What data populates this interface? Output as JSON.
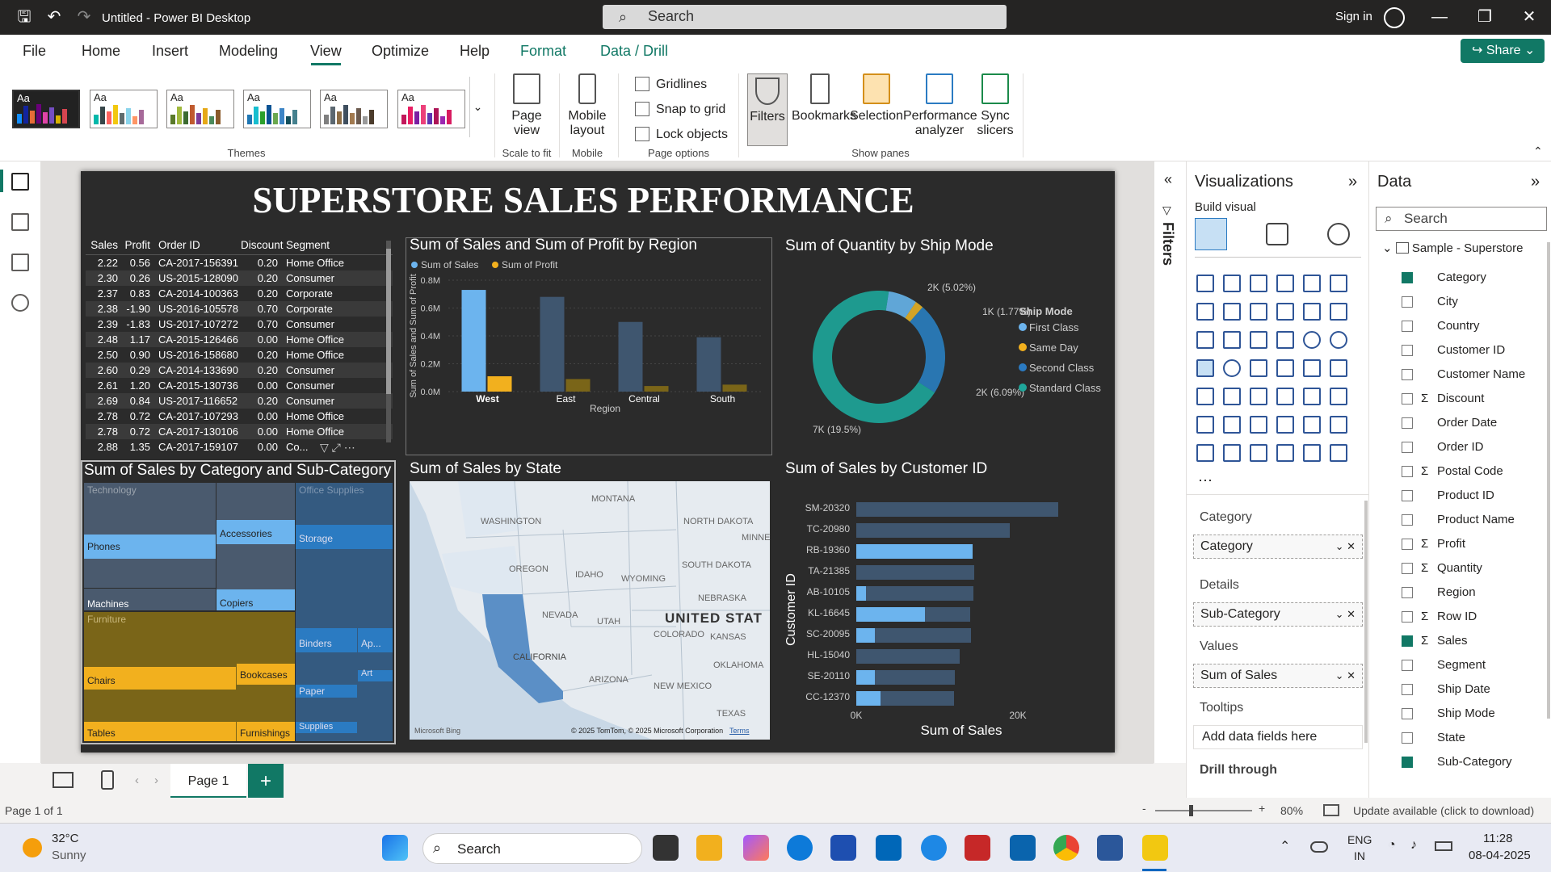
{
  "app": {
    "title": "Untitled - Power BI Desktop",
    "search_placeholder": "Search",
    "signin": "Sign in"
  },
  "menu": {
    "items": [
      "File",
      "Home",
      "Insert",
      "Modeling",
      "View",
      "Optimize",
      "Help",
      "Format",
      "Data / Drill"
    ],
    "share": "Share"
  },
  "ribbon": {
    "themes_label": "Themes",
    "theme_aa": "Aa",
    "page_view": "Page view",
    "scale_to_fit": "Scale to fit",
    "mobile_layout": "Mobile layout",
    "mobile_label": "Mobile",
    "gridlines": "Gridlines",
    "snap_to_grid": "Snap to grid",
    "lock_objects": "Lock objects",
    "page_options_label": "Page options",
    "filters": "Filters",
    "bookmarks": "Bookmarks",
    "selection": "Selection",
    "performance_analyzer": "Performance analyzer",
    "sync_slicers": "Sync slicers",
    "show_panes_label": "Show panes"
  },
  "report": {
    "title": "SUPERSTORE SALES PERFORMANCE",
    "table": {
      "headers": [
        "Sales",
        "Profit",
        "Order ID",
        "Discount",
        "Segment"
      ],
      "rows": [
        [
          "2.22",
          "0.56",
          "CA-2017-156391",
          "0.20",
          "Home Office"
        ],
        [
          "2.30",
          "0.26",
          "US-2015-128090",
          "0.20",
          "Consumer"
        ],
        [
          "2.37",
          "0.83",
          "CA-2014-100363",
          "0.20",
          "Corporate"
        ],
        [
          "2.38",
          "-1.90",
          "US-2016-105578",
          "0.70",
          "Corporate"
        ],
        [
          "2.39",
          "-1.83",
          "US-2017-107272",
          "0.70",
          "Consumer"
        ],
        [
          "2.48",
          "1.17",
          "CA-2015-126466",
          "0.00",
          "Home Office"
        ],
        [
          "2.50",
          "0.90",
          "US-2016-158680",
          "0.20",
          "Home Office"
        ],
        [
          "2.60",
          "0.29",
          "CA-2014-133690",
          "0.20",
          "Consumer"
        ],
        [
          "2.61",
          "1.20",
          "CA-2015-130736",
          "0.00",
          "Consumer"
        ],
        [
          "2.69",
          "0.84",
          "US-2017-116652",
          "0.20",
          "Consumer"
        ],
        [
          "2.78",
          "0.72",
          "CA-2017-107293",
          "0.00",
          "Home Office"
        ],
        [
          "2.78",
          "0.72",
          "CA-2017-130106",
          "0.00",
          "Home Office"
        ],
        [
          "2.88",
          "1.35",
          "CA-2017-159107",
          "0.00",
          "Co..."
        ]
      ]
    },
    "bar_title": "Sum of Sales and Sum of Profit by Region",
    "donut_title": "Sum of Quantity by Ship Mode",
    "treemap_title": "Sum of Sales by Category and Sub-Category",
    "map_title": "Sum of Sales by State",
    "hbar_title": "Sum of Sales by Customer ID",
    "map_labels": [
      "WASHINGTON",
      "MONTANA",
      "NORTH DAKOTA",
      "MINNES",
      "OREGON",
      "IDAHO",
      "SOUTH DAKOTA",
      "WYOMING",
      "NEBRASKA",
      "NEVADA",
      "UTAH",
      "UNITED STAT",
      "COLORADO",
      "KANSAS",
      "CALIFORNIA",
      "ARIZONA",
      "OKLAHOMA",
      "NEW MEXICO",
      "TEXAS"
    ],
    "map_attrib": "© 2025 TomTom, © 2025 Microsoft Corporation",
    "map_terms": "Terms",
    "map_brand": "Microsoft Bing",
    "treemap": {
      "cats": [
        "Technology",
        "Office Supplies",
        "Furniture"
      ],
      "subs": [
        "Phones",
        "Accessories",
        "Storage",
        "Machines",
        "Copiers",
        "Binders",
        "Ap...",
        "Art",
        "Paper",
        "Supplies",
        "Chairs",
        "Bookcases",
        "Tables",
        "Furnishings"
      ]
    }
  },
  "chart_data": [
    {
      "type": "bar",
      "title": "Sum of Sales and Sum of Profit by Region",
      "xlabel": "Region",
      "ylabel": "Sum of Sales and Sum of Profit",
      "categories": [
        "West",
        "East",
        "Central",
        "South"
      ],
      "series": [
        {
          "name": "Sum of Sales",
          "values": [
            0.73,
            0.68,
            0.5,
            0.39
          ],
          "color": "#6cb4ee"
        },
        {
          "name": "Sum of Profit",
          "values": [
            0.11,
            0.09,
            0.04,
            0.05
          ],
          "color": "#f2b01e"
        }
      ],
      "yticks": [
        "0.0M",
        "0.2M",
        "0.4M",
        "0.6M",
        "0.8M"
      ],
      "ylim": [
        0,
        0.8
      ]
    },
    {
      "type": "pie",
      "title": "Sum of Quantity by Ship Mode",
      "legend_title": "Ship Mode",
      "categories": [
        "First Class",
        "Same Day",
        "Second Class",
        "Standard Class"
      ],
      "values": [
        6.09,
        1.77,
        19.5,
        59.0
      ],
      "labels": [
        "2K (5.02%)",
        "1K (1.77%)",
        "2K (6.09%)",
        "7K (19.5%)"
      ],
      "colors": [
        "#6cb4ee",
        "#f2b01e",
        "#2b7bc2",
        "#1fa69a"
      ]
    },
    {
      "type": "bar",
      "title": "Sum of Sales by Customer ID",
      "xlabel": "Sum of Sales",
      "ylabel": "Customer ID",
      "categories": [
        "SM-20320",
        "TC-20980",
        "RB-19360",
        "TA-21385",
        "AB-10105",
        "KL-16645",
        "SC-20095",
        "HL-15040",
        "SE-20110",
        "CC-12370"
      ],
      "values": [
        25000,
        19000,
        14400,
        14600,
        14500,
        14100,
        14200,
        12800,
        12200,
        12100
      ],
      "highlight": [
        0,
        0,
        14400,
        0,
        1200,
        8500,
        2300,
        0,
        2300,
        3000
      ],
      "xticks": [
        "0K",
        "20K"
      ],
      "xlim": [
        0,
        25000
      ]
    }
  ],
  "panes": {
    "filters": "Filters",
    "visualizations": "Visualizations",
    "build_visual": "Build visual",
    "data": "Data",
    "data_search": "Search",
    "wells": [
      {
        "label": "Category",
        "field": "Category"
      },
      {
        "label": "Details",
        "field": "Sub-Category"
      },
      {
        "label": "Values",
        "field": "Sum of Sales"
      }
    ],
    "tooltips": "Tooltips",
    "add_data": "Add data fields here",
    "drill_through": "Drill through",
    "dataset": "Sample - Superstore",
    "fields": [
      {
        "name": "Category",
        "sigma": false,
        "checked": true
      },
      {
        "name": "City",
        "sigma": false,
        "checked": false
      },
      {
        "name": "Country",
        "sigma": false,
        "checked": false
      },
      {
        "name": "Customer ID",
        "sigma": false,
        "checked": false
      },
      {
        "name": "Customer Name",
        "sigma": false,
        "checked": false
      },
      {
        "name": "Discount",
        "sigma": true,
        "checked": false
      },
      {
        "name": "Order Date",
        "sigma": false,
        "checked": false
      },
      {
        "name": "Order ID",
        "sigma": false,
        "checked": false
      },
      {
        "name": "Postal Code",
        "sigma": true,
        "checked": false
      },
      {
        "name": "Product ID",
        "sigma": false,
        "checked": false
      },
      {
        "name": "Product Name",
        "sigma": false,
        "checked": false
      },
      {
        "name": "Profit",
        "sigma": true,
        "checked": false
      },
      {
        "name": "Quantity",
        "sigma": true,
        "checked": false
      },
      {
        "name": "Region",
        "sigma": false,
        "checked": false
      },
      {
        "name": "Row ID",
        "sigma": true,
        "checked": false
      },
      {
        "name": "Sales",
        "sigma": true,
        "checked": true
      },
      {
        "name": "Segment",
        "sigma": false,
        "checked": false
      },
      {
        "name": "Ship Date",
        "sigma": false,
        "checked": false
      },
      {
        "name": "Ship Mode",
        "sigma": false,
        "checked": false
      },
      {
        "name": "State",
        "sigma": false,
        "checked": false
      },
      {
        "name": "Sub-Category",
        "sigma": false,
        "checked": true
      }
    ]
  },
  "bottom": {
    "page_tab": "Page 1",
    "status_page": "Page 1 of 1",
    "zoom": "80%",
    "update": "Update available (click to download)"
  },
  "taskbar": {
    "temp": "32°C",
    "weather": "Sunny",
    "search": "Search",
    "lang1": "ENG",
    "lang2": "IN",
    "time": "11:28",
    "date": "08-04-2025"
  }
}
